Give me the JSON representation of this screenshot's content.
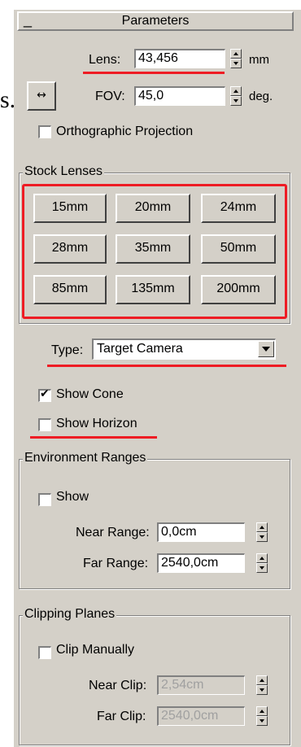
{
  "stray_text": "s.",
  "rollout": {
    "collapse_glyph": "_",
    "title": "Parameters"
  },
  "lens": {
    "label": "Lens:",
    "value": "43,456",
    "unit": "mm"
  },
  "fov": {
    "label": "FOV:",
    "value": "45,0",
    "unit": "deg.",
    "direction_button_icon": "↔"
  },
  "orthographic": {
    "label": "Orthographic Projection",
    "checked": false
  },
  "stock_lenses": {
    "title": "Stock Lenses",
    "buttons": [
      "15mm",
      "20mm",
      "24mm",
      "28mm",
      "35mm",
      "50mm",
      "85mm",
      "135mm",
      "200mm"
    ]
  },
  "type": {
    "label": "Type:",
    "value": "Target Camera"
  },
  "show_cone": {
    "label": "Show Cone",
    "checked": true
  },
  "show_horizon": {
    "label": "Show Horizon",
    "checked": false
  },
  "environment_ranges": {
    "title": "Environment Ranges",
    "show": {
      "label": "Show",
      "checked": false
    },
    "near": {
      "label": "Near Range:",
      "value": "0,0cm"
    },
    "far": {
      "label": "Far Range:",
      "value": "2540,0cm"
    }
  },
  "clipping_planes": {
    "title": "Clipping Planes",
    "clip_manually": {
      "label": "Clip Manually",
      "checked": false
    },
    "near": {
      "label": "Near Clip:",
      "value": "2,54cm"
    },
    "far": {
      "label": "Far Clip:",
      "value": "2540,0cm"
    }
  },
  "colors": {
    "panel": "#d4d0c8",
    "highlight_annotation": "#ee1c24"
  }
}
